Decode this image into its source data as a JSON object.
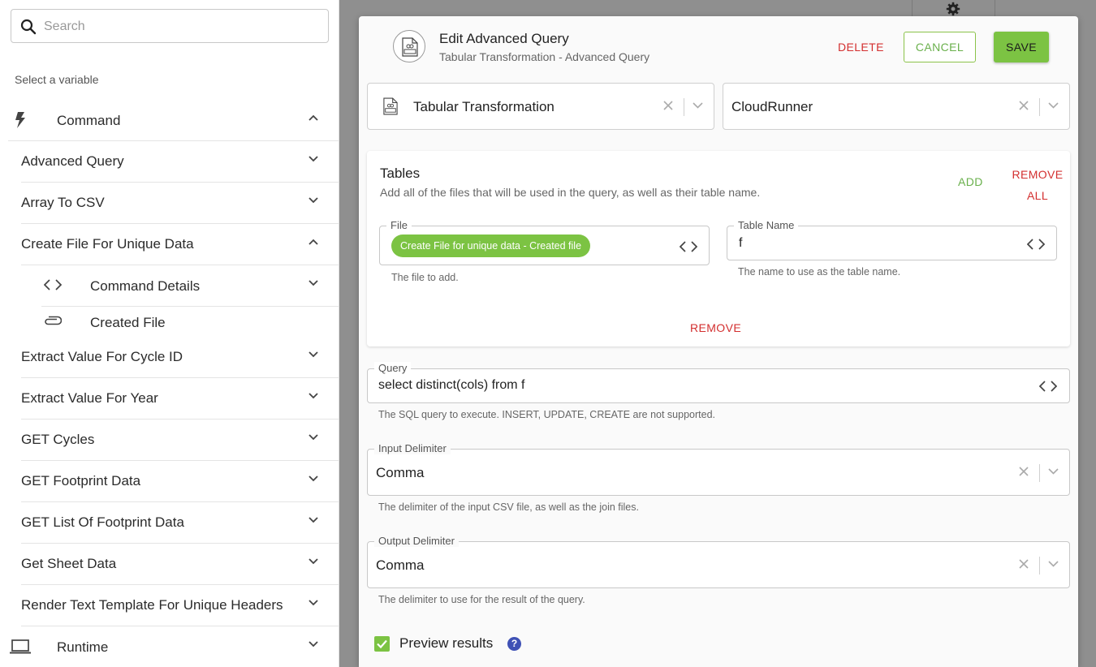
{
  "search": {
    "placeholder": "Search"
  },
  "sidebar": {
    "section_label": "Select a variable",
    "command_group": "Command",
    "items": [
      {
        "label": "Advanced Query"
      },
      {
        "label": "Array To CSV"
      },
      {
        "label": "Create File For Unique Data"
      },
      {
        "label": "Extract Value For Cycle ID"
      },
      {
        "label": "Extract Value For Year"
      },
      {
        "label": "GET Cycles"
      },
      {
        "label": "GET Footprint Data"
      },
      {
        "label": "GET List Of Footprint Data"
      },
      {
        "label": "Get Sheet Data"
      },
      {
        "label": "Render Text Template For Unique Headers"
      }
    ],
    "subitems": [
      {
        "label": "Command Details"
      },
      {
        "label": "Created File"
      }
    ],
    "runtime_group": "Runtime"
  },
  "modal": {
    "title": "Edit Advanced Query",
    "subtitle": "Tabular Transformation - Advanced Query",
    "delete_label": "DELETE",
    "cancel_label": "CANCEL",
    "save_label": "SAVE",
    "integration_select": "Tabular Transformation",
    "runner_select": "CloudRunner",
    "tables": {
      "title": "Tables",
      "description": "Add all of the files that will be used in the query, as well as their table name.",
      "add_label": "ADD",
      "remove_all_label": "REMOVE ALL",
      "file_legend": "File",
      "file_chip": "Create File for unique data - Created file",
      "file_helper": "The file to add.",
      "table_name_legend": "Table Name",
      "table_name_value": "f",
      "table_name_helper": "The name to use as the table name.",
      "remove_label": "REMOVE"
    },
    "query": {
      "legend": "Query",
      "value": "select distinct(cols) from f",
      "helper": "The SQL query to execute. INSERT, UPDATE, CREATE are not supported."
    },
    "input_delimiter": {
      "legend": "Input Delimiter",
      "value": "Comma",
      "helper": "The delimiter of the input CSV file, as well as the join files."
    },
    "output_delimiter": {
      "legend": "Output Delimiter",
      "value": "Comma",
      "helper": "The delimiter to use for the result of the query."
    },
    "preview_label": "Preview results",
    "help_glyph": "?"
  },
  "colors": {
    "accent_green": "#7cc343",
    "danger_red": "#d32f2f",
    "help_blue": "#3f51b5",
    "backdrop_gray": "#8f8f8f"
  },
  "icons": {
    "search": "search-icon",
    "command": "lightning-bolt-icon",
    "code": "code-brackets-icon",
    "attachment": "paperclip-icon",
    "runtime": "laptop-icon",
    "gear": "gear-icon"
  }
}
